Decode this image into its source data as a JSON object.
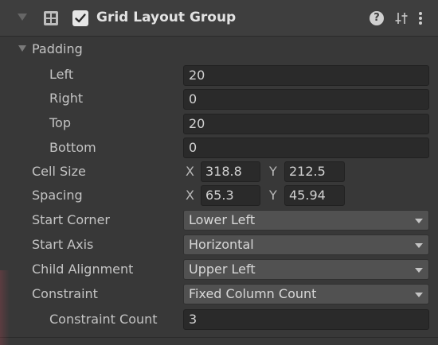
{
  "component": {
    "title": "Grid Layout Group",
    "enabled": true,
    "icons": [
      "foldout-arrow-icon",
      "grid-layout-icon",
      "help-icon",
      "presets-icon",
      "context-menu-icon"
    ]
  },
  "padding": {
    "label": "Padding",
    "expanded": true,
    "left": {
      "label": "Left",
      "value": "20"
    },
    "right": {
      "label": "Right",
      "value": "0"
    },
    "top": {
      "label": "Top",
      "value": "20"
    },
    "bottom": {
      "label": "Bottom",
      "value": "0"
    }
  },
  "cell_size": {
    "label": "Cell Size",
    "x_label": "X",
    "x": "318.8",
    "y_label": "Y",
    "y": "212.5"
  },
  "spacing": {
    "label": "Spacing",
    "x_label": "X",
    "x": "65.3",
    "y_label": "Y",
    "y": "45.94"
  },
  "start_corner": {
    "label": "Start Corner",
    "value": "Lower Left"
  },
  "start_axis": {
    "label": "Start Axis",
    "value": "Horizontal"
  },
  "child_alignment": {
    "label": "Child Alignment",
    "value": "Upper Left"
  },
  "constraint": {
    "label": "Constraint",
    "value": "Fixed Column Count"
  },
  "constraint_count": {
    "label": "Constraint Count",
    "value": "3"
  },
  "colors": {
    "panel_bg": "#383838",
    "header_bg": "#3e3e3e",
    "field_bg": "#2a2a2a",
    "dropdown_bg": "#515151",
    "text": "#c4c4c4"
  }
}
